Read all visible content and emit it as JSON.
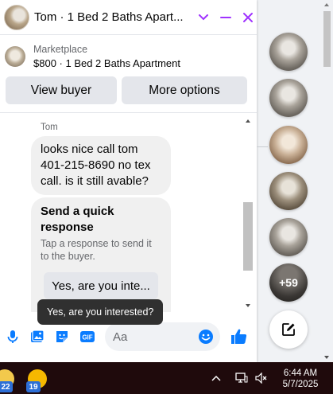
{
  "chat": {
    "title": "Tom · 1 Bed 2 Baths Apart...",
    "listing": {
      "kind": "Marketplace",
      "name": "$800 · 1 Bed 2 Baths Apartment"
    },
    "actions": {
      "view_buyer": "View buyer",
      "more_options": "More options"
    },
    "sender": "Tom",
    "message": "looks nice call tom 401-215-8690 no tex call. is it still avable?",
    "quick_reply": {
      "title": "Send a quick response",
      "subtitle": "Tap a response to send it to the buyer.",
      "button": "Yes, are you inte...",
      "tooltip": "Yes, are you interested?"
    },
    "composer": {
      "placeholder": "Aa",
      "icons": [
        "microphone-icon",
        "photo-icon",
        "sticker-icon",
        "gif-icon",
        "emoji-icon",
        "like-icon"
      ]
    }
  },
  "rail": {
    "more_count": "+59"
  },
  "taskbar": {
    "apps": [
      {
        "badge": "22"
      },
      {
        "badge": "19"
      }
    ],
    "time": "6:44 AM",
    "date": "5/7/2025"
  },
  "colors": {
    "accent": "#a033ff",
    "messenger_blue": "#0a7cff",
    "bubble": "#f0f0f0",
    "button_gray": "#e4e6eb",
    "taskbar": "#1f0a0c"
  }
}
